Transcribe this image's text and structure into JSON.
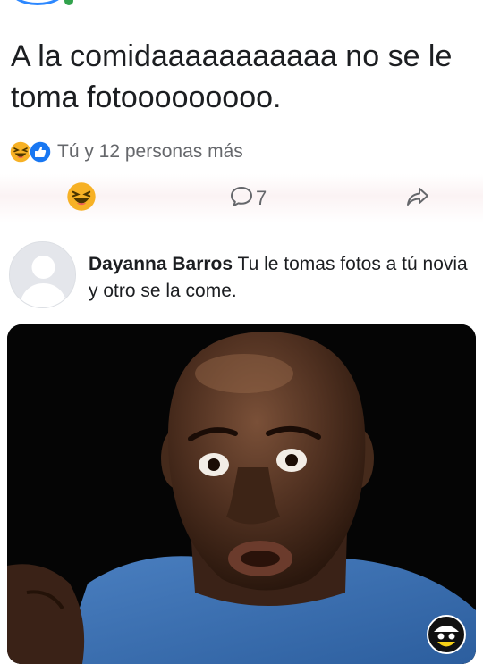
{
  "post": {
    "text": "A la comidaaaaaaaaaaa no se le toma fotooooooooo.",
    "reactions_summary": "Tú y 12 personas más",
    "reaction_types": [
      "haha-icon",
      "like-icon"
    ],
    "comment_count": "7"
  },
  "comment": {
    "author": "Dayanna Barros",
    "text": "Tu le tomas fotos a tú novia  y otro se la come."
  },
  "colors": {
    "facebook_blue": "#1877f2",
    "secondary_text": "#65676b",
    "haha_yellow": "#f7b125"
  }
}
